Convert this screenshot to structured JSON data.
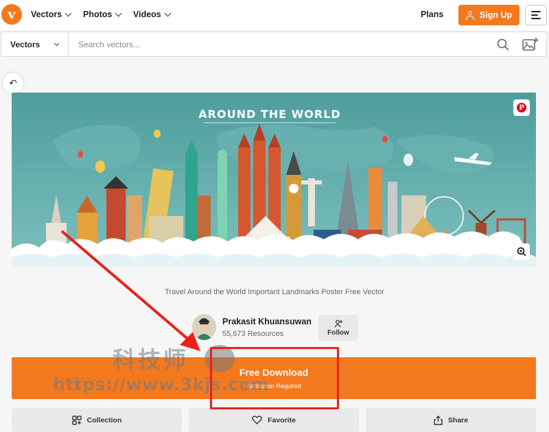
{
  "nav": {
    "logo_letter": "v",
    "items": [
      {
        "label": "Vectors"
      },
      {
        "label": "Photos"
      },
      {
        "label": "Videos"
      }
    ],
    "plans_label": "Plans",
    "signup_label": "Sign Up"
  },
  "search": {
    "type_label": "Vectors",
    "placeholder": "Search vectors..."
  },
  "asset": {
    "banner_text": "AROUND THE  WORLD",
    "caption": "Travel Around the World Important Landmarks Poster Free Vector",
    "author_name": "Prakasit Khuansuwan",
    "author_resources": "55,673 Resources",
    "follow_label": "Follow",
    "pin_letter": "P"
  },
  "download": {
    "title": "Free Download",
    "subtitle": "Attribution Required"
  },
  "actions": {
    "collection": "Collection",
    "favorite": "Favorite",
    "share": "Share"
  },
  "watermark": {
    "text_cn": "科技师",
    "url": "https://www.3kjs.com"
  },
  "colors": {
    "accent": "#f3791f",
    "annotation": "#e8221b",
    "sky": "#5fa9a7"
  }
}
